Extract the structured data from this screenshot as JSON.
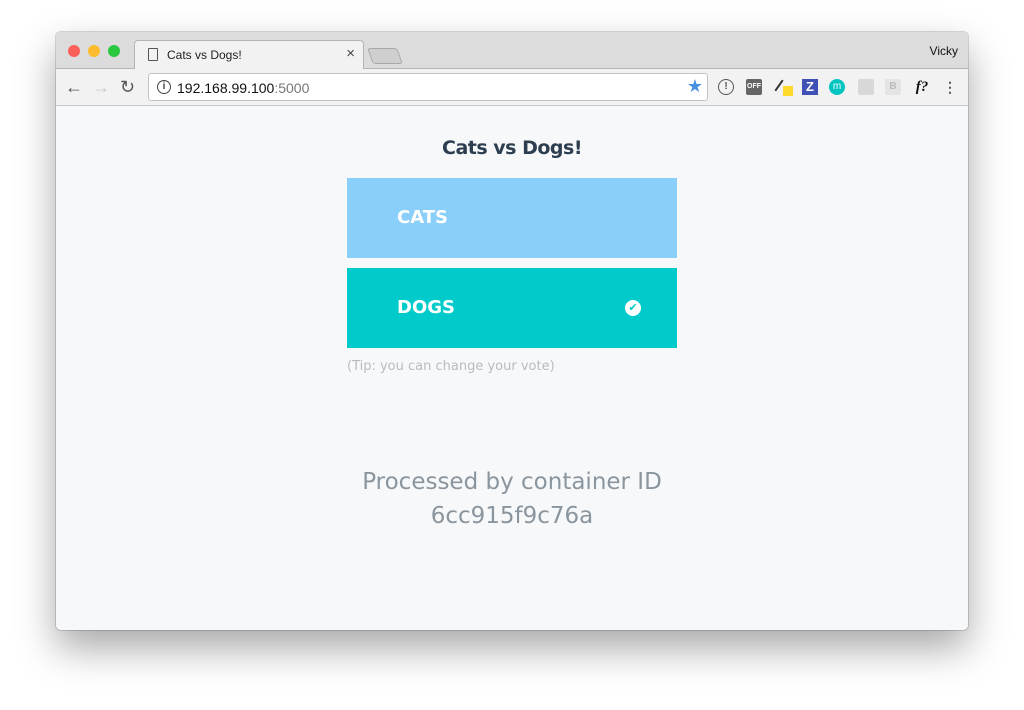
{
  "browser": {
    "tab_title": "Cats vs Dogs!",
    "user": "Vicky",
    "url_host": "192.168.99.100",
    "url_port": ":5000"
  },
  "extensions": [
    "info-icon",
    "off-icon",
    "eyedropper-icon",
    "z-icon",
    "m-icon",
    "rss-icon",
    "b-icon",
    "f?-icon",
    "menu-icon"
  ],
  "extension_labels": {
    "off": "OFF",
    "z": "Z",
    "m": "m",
    "b": "B",
    "f": "f?"
  },
  "page": {
    "title": "Cats vs Dogs!",
    "options": [
      {
        "label": "CATS",
        "color": "#8acffa",
        "selected": false
      },
      {
        "label": "DOGS",
        "color": "#00cbca",
        "selected": true
      }
    ],
    "tip": "(Tip: you can change your vote)",
    "processed_label": "Processed by container ID",
    "container_id": "6cc915f9c76a"
  }
}
